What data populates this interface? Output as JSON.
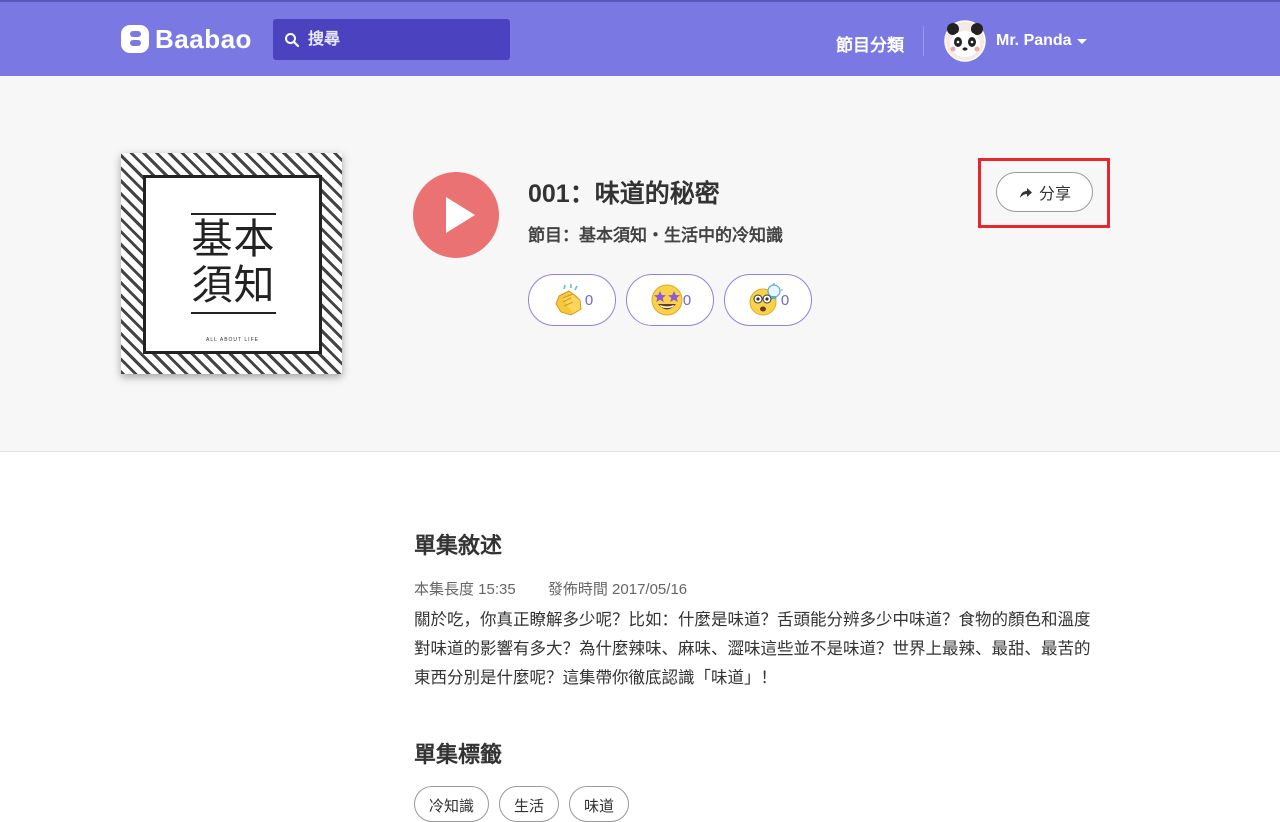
{
  "header": {
    "logo_text": "Baabao",
    "search_placeholder": "搜尋",
    "nav_category": "節目分類",
    "user_name": "Mr. Panda"
  },
  "episode": {
    "cover_title": "基本\n須知",
    "cover_subtitle": "ALL ABOUT LIFE",
    "title": "001：味道的秘密",
    "show": "節目：基本須知・生活中的冷知識",
    "share_label": "分享",
    "reactions": [
      {
        "icon": "clapping-hands-icon",
        "count": "0"
      },
      {
        "icon": "star-struck-icon",
        "count": "0"
      },
      {
        "icon": "lightbulb-idea-icon",
        "count": "0"
      }
    ]
  },
  "description": {
    "heading": "單集敘述",
    "length": "本集長度 15:35",
    "published": "發佈時間 2017/05/16",
    "text": "關於吃，你真正瞭解多少呢？比如：什麼是味道？舌頭能分辨多少中味道？食物的顏色和溫度對味道的影響有多大？為什麼辣味、麻味、澀味這些並不是味道？世界上最辣、最甜、最苦的東西分別是什麼呢？這集帶你徹底認識「味道」！"
  },
  "tags": {
    "heading": "單集標籤",
    "items": [
      "冷知識",
      "生活",
      "味道"
    ]
  },
  "colors": {
    "header_bg": "#7a78e3",
    "search_bg": "#4b42c0",
    "play_button": "#ea7272",
    "reaction_border": "#8a84e0",
    "highlight_box": "#e8262d"
  }
}
